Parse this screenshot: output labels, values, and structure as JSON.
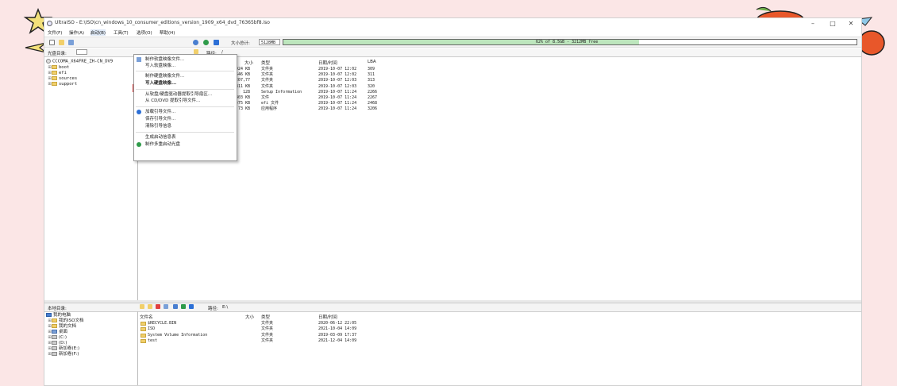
{
  "window": {
    "title": "UltraISO - E:\\ISO\\cn_windows_10_consumer_editions_version_1909_x64_dvd_76365bf8.iso",
    "controls": [
      "–",
      "□",
      "✕"
    ]
  },
  "menubar": [
    "文件(F)",
    "操作(A)",
    "启动(B)",
    "工具(T)",
    "选项(O)",
    "帮助(H)"
  ],
  "toolbar": {
    "size_label": "大小总计:",
    "size_value": "5128MB",
    "capacity_text": "62% of 8.5GB - 3212MB free",
    "capacity_fraction": 0.62
  },
  "upper_path": {
    "label": "光盘目录:",
    "path_label": "路径:",
    "path_value": "/"
  },
  "iso_tree": {
    "root": "CCCOMA_X64FRE_ZH-CN_DV9",
    "items": [
      "boot",
      "efi",
      "sources",
      "support"
    ]
  },
  "iso_files": {
    "headers": {
      "size": "大小",
      "type": "类型",
      "date": "日期/时间",
      "lba": "LBA"
    },
    "rows": [
      {
        "size": "17,924 KB",
        "type": "文件夹",
        "date": "2019-10-07 12:02",
        "lba": "309"
      },
      {
        "size": "21,646 KB",
        "type": "文件夹",
        "date": "2019-10-07 12:02",
        "lba": "311"
      },
      {
        "size": "5,207,77",
        "type": "文件夹",
        "date": "2019-10-07 12:03",
        "lba": "313"
      },
      {
        "size": "311 KB",
        "type": "文件夹",
        "date": "2019-10-07 12:03",
        "lba": "320"
      },
      {
        "size": "128",
        "type": "Setup Information",
        "date": "2019-10-07 11:24",
        "lba": "2266"
      },
      {
        "size": "403 KB",
        "type": "文件",
        "date": "2019-10-07 11:24",
        "lba": "2267"
      },
      {
        "size": "1,475 KB",
        "type": "efi 文件",
        "date": "2019-10-07 11:24",
        "lba": "2468"
      },
      {
        "size": "73 KB",
        "type": "应用程序",
        "date": "2019-10-07 11:24",
        "lba": "3206"
      }
    ]
  },
  "boot_menu": {
    "items": [
      "制作软盘映像文件...",
      "写入软盘映像...",
      "制作硬盘映像文件...",
      "写入硬盘映像...",
      "从软盘/硬盘驱动器提取引导扇区...",
      "从 CD/DVD 提取引导文件...",
      "加载引导文件...",
      "保存引导文件...",
      "清除引导信息",
      "生成启动信息表",
      "制作多重启动光盘"
    ],
    "highlighted_index": 3
  },
  "lower_path": {
    "label": "本地目录:",
    "path_label": "路径:",
    "path_value": "E:\\"
  },
  "local_tree": {
    "root": "我的电脑",
    "items": [
      "我的ISO文档",
      "我的文档",
      "桌面",
      "(C:)",
      "(D:)",
      "新加卷(E:)",
      "新加卷(F:)"
    ]
  },
  "local_files": {
    "headers": {
      "name": "文件名",
      "size": "大小",
      "type": "类型",
      "date": "日期/时间"
    },
    "rows": [
      {
        "name": "$RECYCLE.BIN",
        "type": "文件夹",
        "date": "2020-06-12 22:05"
      },
      {
        "name": "ISO",
        "type": "文件夹",
        "date": "2021-10-04 14:09"
      },
      {
        "name": "System Volume Information",
        "type": "文件夹",
        "date": "2019-03-09 17:37"
      },
      {
        "name": "test",
        "type": "文件夹",
        "date": "2021-12-04 14:09"
      }
    ]
  },
  "colors": {
    "background": "#fbe6e6",
    "capacity_fill": "#bde6bd",
    "highlight_border": "#d23b3b"
  }
}
